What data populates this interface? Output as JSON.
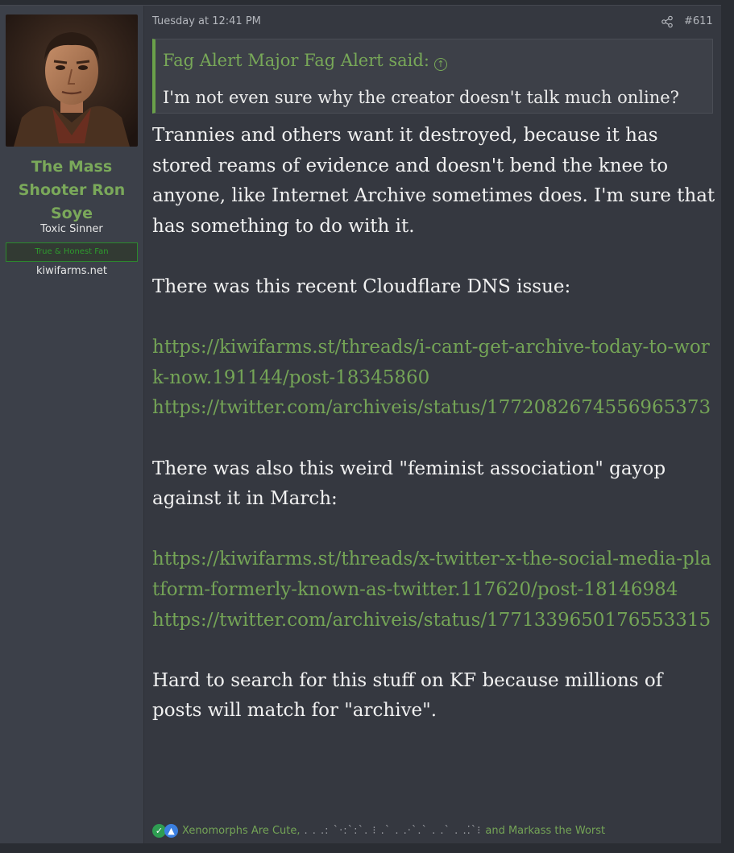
{
  "post": {
    "date": "Tuesday at 12:41 PM",
    "number": "#611",
    "share_icon": "share-icon"
  },
  "user": {
    "name": "The Mass Shooter Ron Soye",
    "title": "Toxic Sinner",
    "banner": "True & Honest Fan",
    "extra": "kiwifarms.net",
    "avatar_icon": "avatar-portrait"
  },
  "quote": {
    "author": "Fag Alert Major Fag Alert said:",
    "arrow_icon": "arrow-up-circle-icon",
    "text": "I'm not even sure why the creator doesn't talk much online?"
  },
  "body": {
    "p1": "Trannies and others want it destroyed, because it has stored reams of evidence and doesn't bend the knee to anyone, like Internet Archive sometimes does. I'm sure that has something to do with it.",
    "p2": "There was this recent Cloudflare DNS issue:",
    "link1": "https://kiwifarms.st/threads/i-cant-get-archive-today-to-work-now.191144/post-18345860",
    "link2": "https://twitter.com/archiveis/status/1772082674556965373",
    "p3": "There was also this weird \"feminist association\" gayop against it in March:",
    "link3": "https://kiwifarms.st/threads/x-twitter-x-the-social-media-platform-formerly-known-as-twitter.117620/post-18146984",
    "link4": "https://twitter.com/archiveis/status/1771339650176553315",
    "p4": "Hard to search for this stuff on KF because millions of posts will match for \"archive\"."
  },
  "reactions": {
    "first": "Xenomorphs Are Cute,",
    "obscured": ". . .: `·:`:`. ⁝ .`  . .·`.`  . .`  . .⁚`⁝",
    "last": "and Markass the Worst"
  },
  "colors": {
    "accent_green": "#74a456",
    "post_bg": "#353840",
    "user_bg": "#3c4049"
  }
}
